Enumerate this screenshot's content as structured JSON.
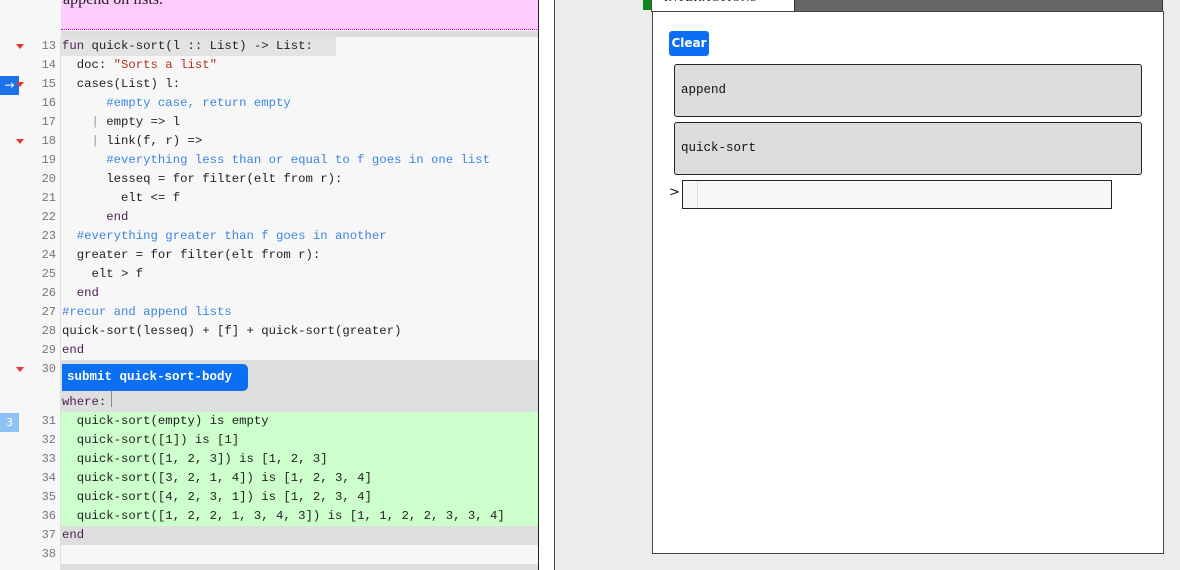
{
  "editor": {
    "prose_text": "append on lists.",
    "lines": [
      {
        "n": "13",
        "fold": true
      },
      {
        "n": "14"
      },
      {
        "n": "15",
        "fold": true
      },
      {
        "n": "16"
      },
      {
        "n": "17"
      },
      {
        "n": "18",
        "fold": true
      },
      {
        "n": "19"
      },
      {
        "n": "20"
      },
      {
        "n": "21"
      },
      {
        "n": "22"
      },
      {
        "n": "23"
      },
      {
        "n": "24"
      },
      {
        "n": "25"
      },
      {
        "n": "26"
      },
      {
        "n": "27"
      },
      {
        "n": "28"
      },
      {
        "n": "29"
      },
      {
        "n": "30",
        "fold": true
      },
      {
        "n": "31"
      },
      {
        "n": "32"
      },
      {
        "n": "33"
      },
      {
        "n": "34"
      },
      {
        "n": "35"
      },
      {
        "n": "36"
      },
      {
        "n": "37"
      },
      {
        "n": "38"
      }
    ],
    "code": {
      "l13": {
        "kw": "fun",
        "rest": " quick-sort(l :: List) -> List:"
      },
      "l14": {
        "pre": "  doc: ",
        "str": "\"Sorts a list\""
      },
      "l15": "  cases(List) l:",
      "l16": "      #empty case, return empty",
      "l17": {
        "bar": "    | ",
        "rest": "empty => l"
      },
      "l18": {
        "bar": "    | ",
        "rest": "link(f, r) =>"
      },
      "l19": "      #everything less than or equal to f goes in one list",
      "l20": "      lesseq = for filter(elt from r):",
      "l21": "        elt <= f",
      "l22": "      end",
      "l23": "  #everything greater than f goes in another",
      "l24": "  greater = for filter(elt from r):",
      "l25": "    elt > f",
      "l26": "  end",
      "l27": "#recur and append lists",
      "l28": "quick-sort(lesseq) + [f] + quick-sort(greater)",
      "l29": "end",
      "l30_chip": "submit quick-sort-body",
      "l30_where": "where:",
      "l31": "  quick-sort(empty) is empty",
      "l32": "  quick-sort([1]) is [1]",
      "l33": "  quick-sort([1, 2, 3]) is [1, 2, 3]",
      "l34": "  quick-sort([3, 2, 1, 4]) is [1, 2, 3, 4]",
      "l35": "  quick-sort([4, 2, 3, 1]) is [1, 2, 3, 4]",
      "l36": "  quick-sort([1, 2, 2, 1, 3, 4, 3]) is [1, 1, 2, 2, 3, 3, 4]",
      "l37": "end",
      "l38": ""
    },
    "markers": {
      "arrow_icon": "→",
      "test_count": "3"
    }
  },
  "interactions": {
    "tab_label": "INTERACTIONS",
    "clear_label": "Clear",
    "definitions": [
      "append",
      "quick-sort"
    ],
    "prompt": ">",
    "input_value": ""
  },
  "colors": {
    "accent": "#0a6ff2",
    "prose_bg": "#ffccff",
    "test_pass_bg": "#ccffcc",
    "fold_marker": "#ee3333",
    "status_green": "#0a8a1a"
  }
}
